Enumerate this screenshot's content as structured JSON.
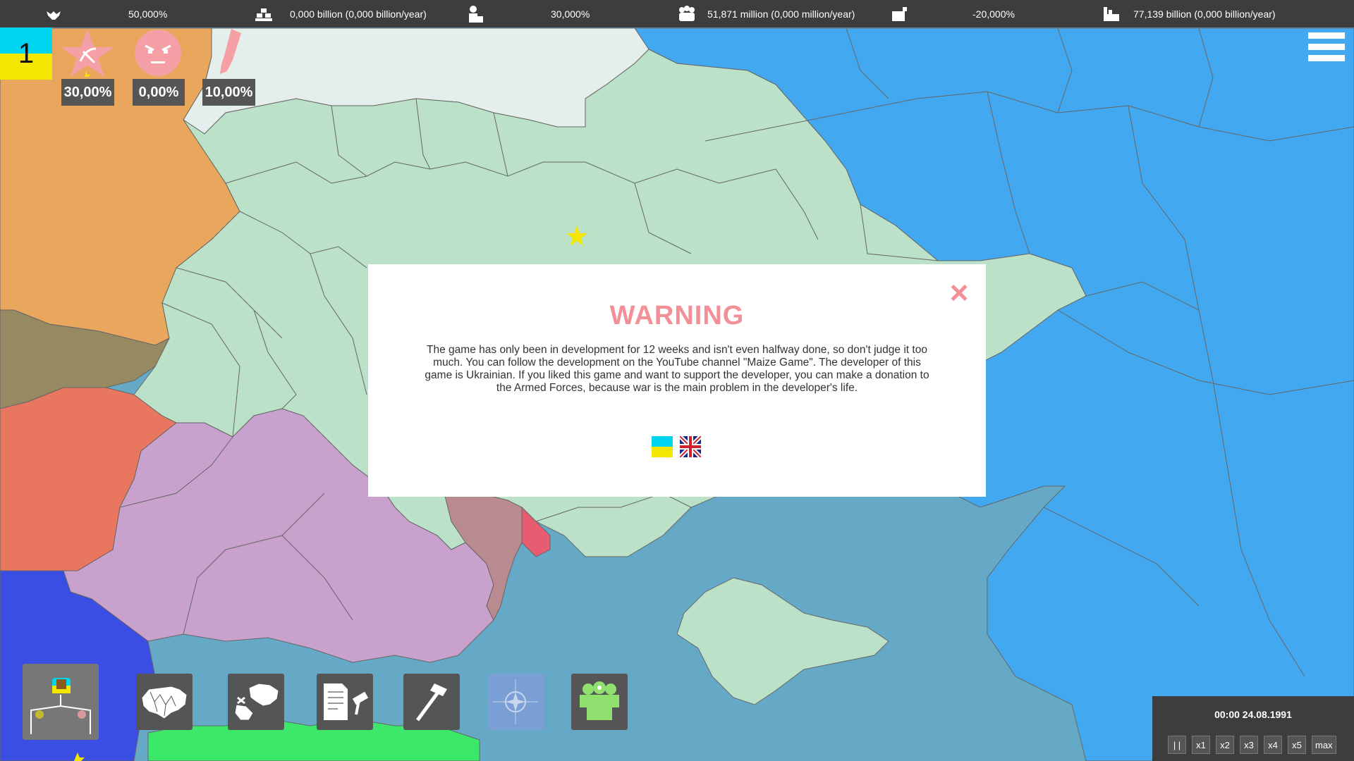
{
  "resources": [
    {
      "icon": "bird-icon",
      "value": "50,000%"
    },
    {
      "icon": "gold-bars-icon",
      "value": "0,000 billion (0,000 billion/year)"
    },
    {
      "icon": "worker-icon",
      "value": "30,000%"
    },
    {
      "icon": "population-icon",
      "value": "51,871 million (0,000 million/year)"
    },
    {
      "icon": "money-box-icon",
      "value": "-20,000%"
    },
    {
      "icon": "factory-icon",
      "value": "77,139 billion (0,000 billion/year)"
    }
  ],
  "country": {
    "rank": "1",
    "flag_colors": [
      "#00d5f0",
      "#f3e600"
    ],
    "indicators": [
      {
        "icon": "communist-star-icon",
        "value": "30,00%"
      },
      {
        "icon": "angry-face-icon",
        "value": "0,00%"
      },
      {
        "icon": "missile-icon",
        "value": "10,00%"
      }
    ]
  },
  "dialog": {
    "title": "WARNING",
    "body": "The game has only been in development for 12 weeks and isn't even halfway done, so don't judge it too much. You can follow the development on the YouTube channel \"Maize Game\". The developer of this game is Ukrainian. If you liked this game and want to support the developer, you can make a donation to the Armed Forces, because war is the main problem in the developer's life.",
    "close_label": "×",
    "languages": [
      "ukraine-flag-icon",
      "uk-flag-icon"
    ]
  },
  "toolbar": [
    {
      "name": "diplomacy-tool",
      "icon": "diplomacy-icon"
    },
    {
      "name": "regions-tool",
      "icon": "map-regions-icon"
    },
    {
      "name": "war-tool",
      "icon": "war-map-icon"
    },
    {
      "name": "laws-tool",
      "icon": "document-gavel-icon"
    },
    {
      "name": "build-tool",
      "icon": "hammer-icon"
    },
    {
      "name": "alliance-tool",
      "icon": "nato-icon"
    },
    {
      "name": "people-tool",
      "icon": "people-icon"
    }
  ],
  "time": {
    "datetime": "00:00 24.08.1991",
    "speeds": [
      "| |",
      "x1",
      "x2",
      "x3",
      "x4",
      "x5",
      "max"
    ]
  },
  "colors": {
    "ukraine": "#bbe1c8",
    "russia": "#42a9f0",
    "belarus": "#e4efec",
    "poland": "#e8a75c",
    "slovakia": "#978962",
    "hungary": "#e9765f",
    "romania": "#c8a1cd",
    "moldova": "#b98a90",
    "transnistria": "#e65d72",
    "sea": "#66a9c6",
    "serbia": "#3a4ee3",
    "bulgaria": "#3be86a",
    "accent": "#f28f97"
  }
}
